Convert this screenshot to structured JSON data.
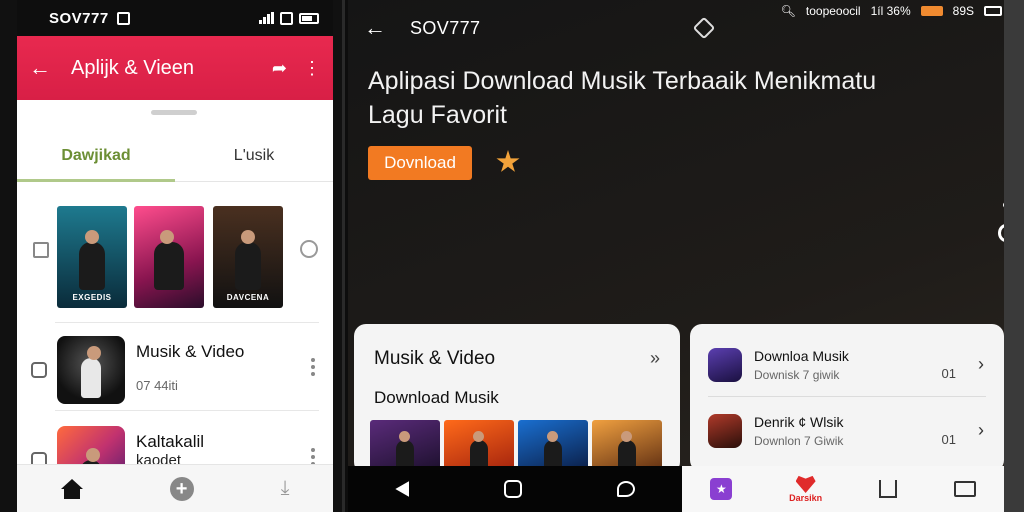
{
  "left_phone": {
    "status": {
      "title": "SOV777"
    },
    "appbar": {
      "title": "Aplijk & Vieen"
    },
    "tabs": [
      {
        "label": "Dawjikad",
        "active": true
      },
      {
        "label": "L'usik",
        "active": false
      }
    ],
    "covers": [
      {
        "caption": "EXGEDIS",
        "colors": [
          "#0f4f63",
          "#0a2b3a"
        ]
      },
      {
        "caption": "",
        "colors": [
          "#e0407a",
          "#3a0f3a"
        ]
      },
      {
        "caption": "DAVCENA",
        "colors": [
          "#3a2417",
          "#111111"
        ]
      }
    ],
    "list": [
      {
        "title": "Musik & Video",
        "subtitle": "07 44iti"
      },
      {
        "title": "Kaltakalil",
        "subtitle": "kaodet"
      }
    ]
  },
  "right_panel": {
    "status": {
      "left": "SOV777",
      "carrier": "toopeoocil",
      "signal": "1íl 36%",
      "battery": "89S"
    },
    "headline": "Aplipasi Download Musik Terbaaik Menikmatu Lagu Favorit",
    "download_button": "Dovnload",
    "card_a": {
      "title": "Musik & Video",
      "subtitle": "Download Musik"
    },
    "card_b": [
      {
        "title": "Downloa Musik",
        "subtitle": "Downisk 7 giwik",
        "count": "01"
      },
      {
        "title": "Denrik ¢ Wlsik",
        "subtitle": "Downlon 7 Giwik",
        "count": "01"
      }
    ],
    "tabbar": {
      "center_label": "Darsikn"
    }
  },
  "colors": {
    "accent_red": "#e8294f",
    "accent_orange": "#f27a22",
    "tab_green": "#6c8f35"
  }
}
